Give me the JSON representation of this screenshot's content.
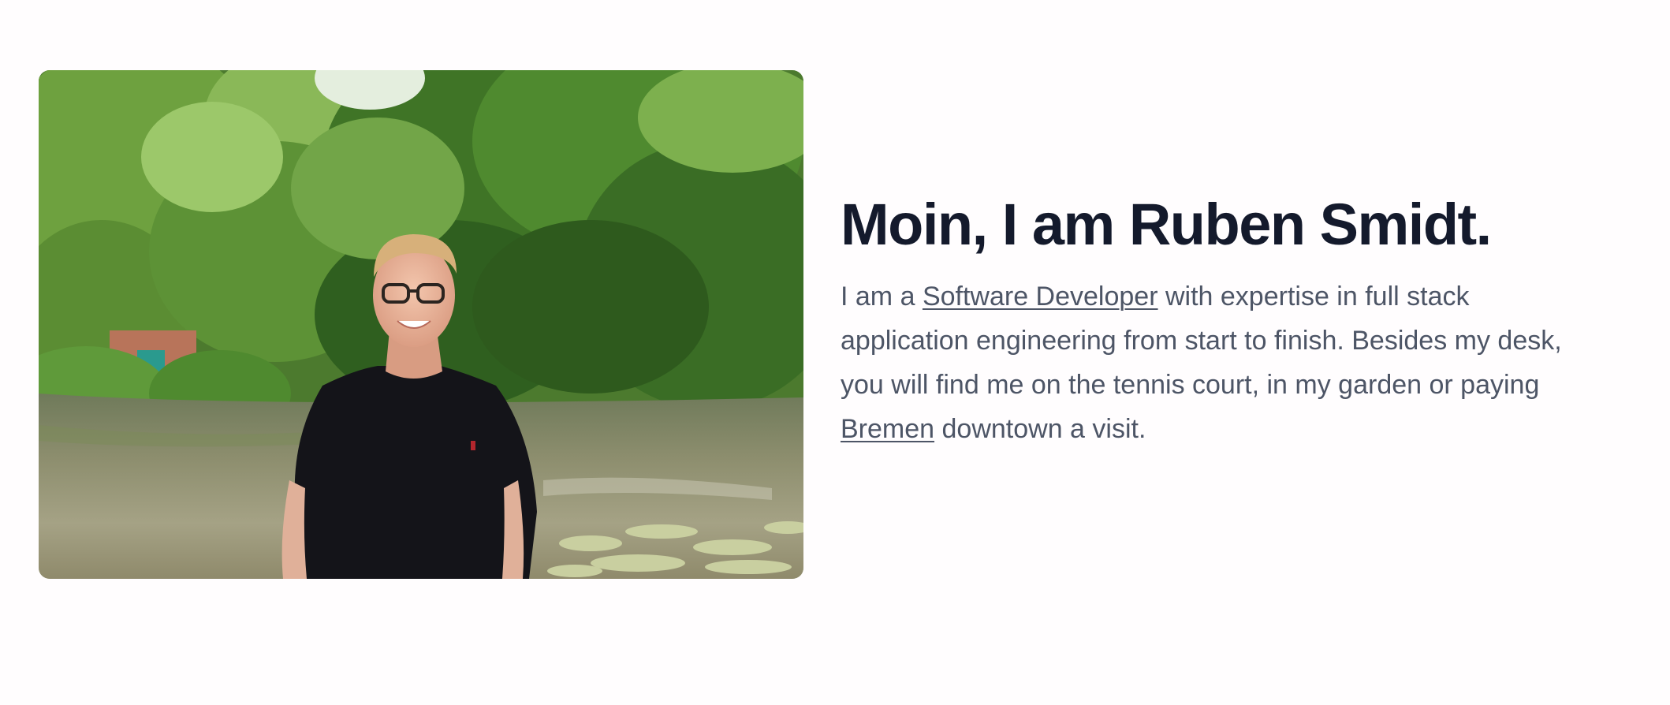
{
  "hero": {
    "photo_alt": "Ruben Smidt standing in front of a lake with trees",
    "headline": "Moin, I am Ruben Smidt.",
    "bio": {
      "prefix": "I am a ",
      "role_link": "Software Developer",
      "middle": " with expertise in full stack application engineering from start to finish. Besides my desk, you will find me on the tennis court, in my garden or paying ",
      "city_link": "Bremen",
      "suffix": " downtown a visit."
    }
  },
  "colors": {
    "background": "#fffdfe",
    "headline": "#141a2c",
    "body_text": "#4d5566"
  }
}
